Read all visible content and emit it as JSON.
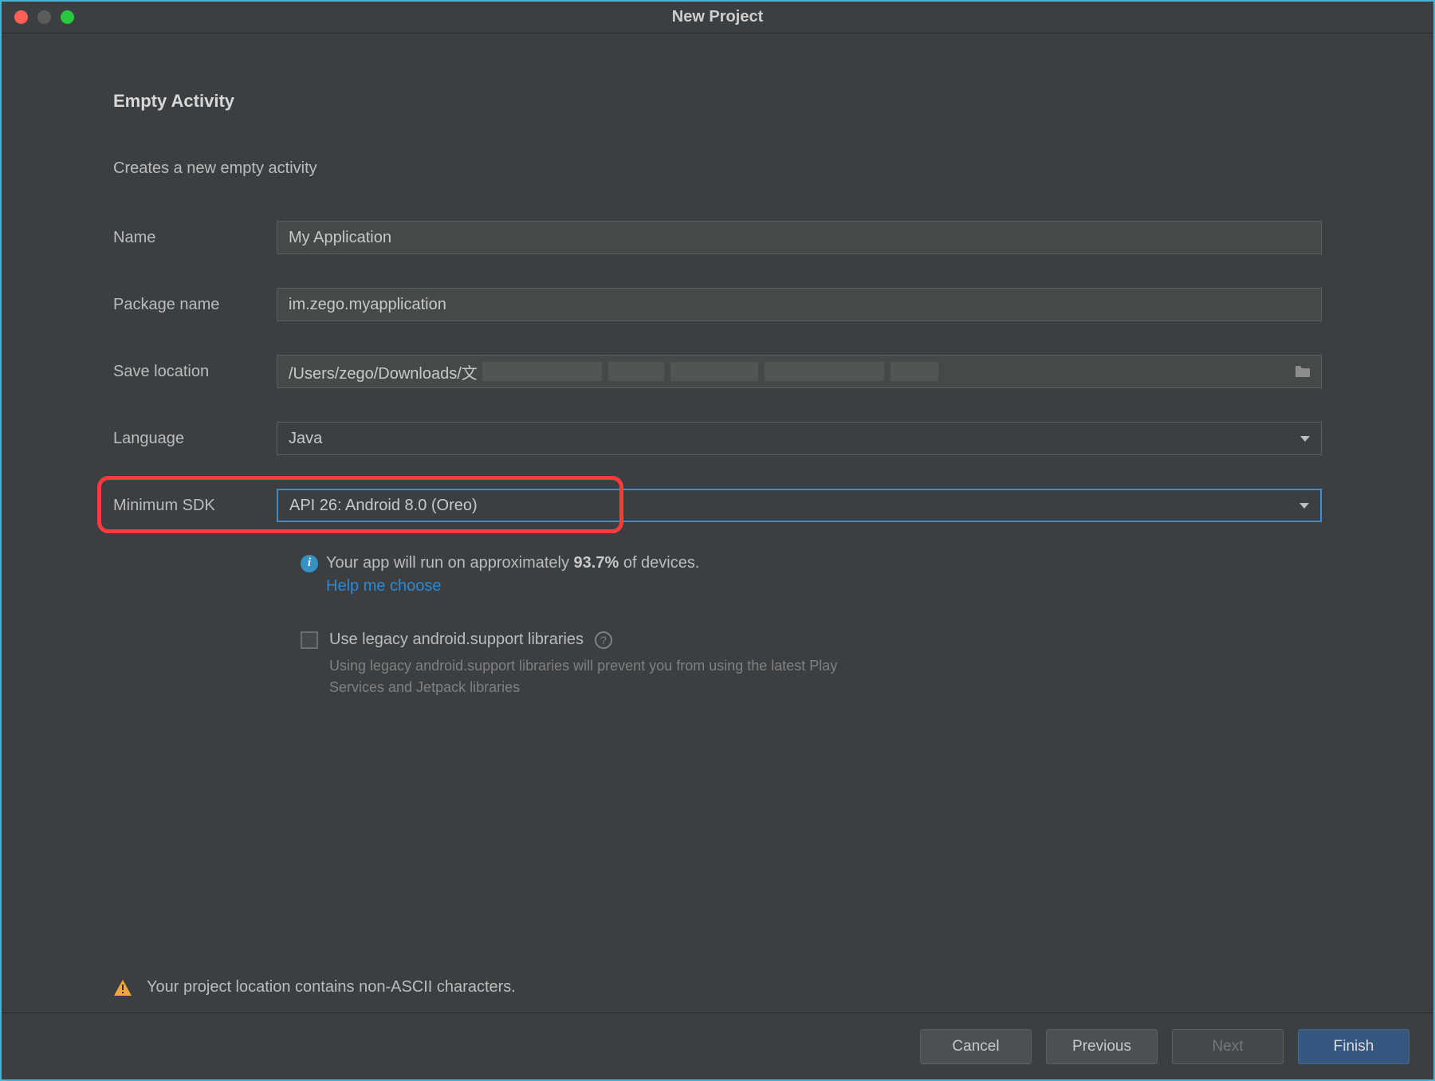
{
  "window": {
    "title": "New Project"
  },
  "header": {
    "activity_title": "Empty Activity",
    "description": "Creates a new empty activity"
  },
  "form": {
    "name_label": "Name",
    "name_value": "My Application",
    "package_label": "Package name",
    "package_value": "im.zego.myapplication",
    "location_label": "Save location",
    "location_value": "/Users/zego/Downloads/文",
    "language_label": "Language",
    "language_value": "Java",
    "minsdk_label": "Minimum SDK",
    "minsdk_value": "API 26: Android 8.0 (Oreo)"
  },
  "info": {
    "text_prefix": "Your app will run on approximately ",
    "percent": "93.7%",
    "text_suffix": " of devices.",
    "link": "Help me choose"
  },
  "legacy": {
    "label": "Use legacy android.support libraries",
    "sub": "Using legacy android.support libraries will prevent you from using the latest Play Services and Jetpack libraries"
  },
  "warning": {
    "text": "Your project location contains non-ASCII characters."
  },
  "footer": {
    "cancel": "Cancel",
    "previous": "Previous",
    "next": "Next",
    "finish": "Finish"
  }
}
